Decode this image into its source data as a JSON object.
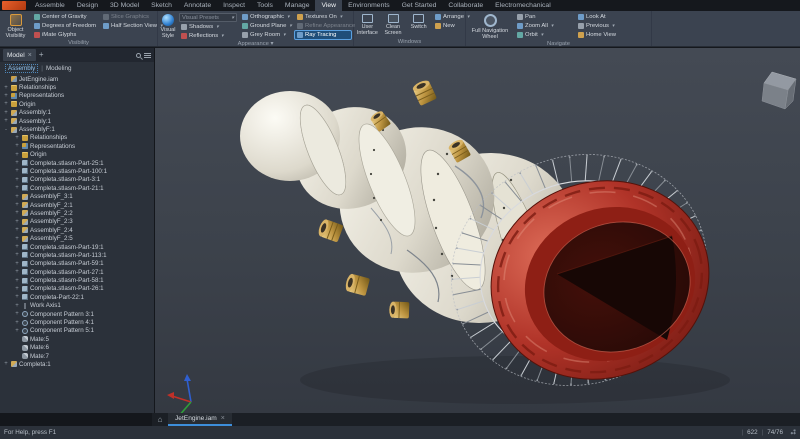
{
  "app": {
    "tabs": [
      {
        "label": "Assemble"
      },
      {
        "label": "Design"
      },
      {
        "label": "3D Model"
      },
      {
        "label": "Sketch"
      },
      {
        "label": "Annotate"
      },
      {
        "label": "Inspect"
      },
      {
        "label": "Tools"
      },
      {
        "label": "Manage"
      },
      {
        "label": "View",
        "cls": "active"
      },
      {
        "label": "Environments"
      },
      {
        "label": "Get Started"
      },
      {
        "label": "Collaborate"
      },
      {
        "label": "Electromechanical"
      }
    ]
  },
  "ribbon": {
    "visibility": {
      "label": "Visibility",
      "big": "Object Visibility",
      "col1": [
        "Center of Gravity",
        "Degrees of Freedom",
        "iMate Glyphs"
      ],
      "col2": [
        "Slice Graphics",
        "Half Section View"
      ]
    },
    "appearance": {
      "label": "Appearance ▾",
      "big": "Visual Style",
      "colA": [
        "Visual Presets",
        "Shadows",
        "Reflections"
      ],
      "colB": [
        "Orthographic",
        "Ground Plane",
        "Grey Room"
      ],
      "colC": [
        "Textures On",
        "Refine Appearance",
        "Ray Tracing"
      ]
    },
    "windows": {
      "label": "Windows",
      "items": [
        "User Interface",
        "Clean Screen",
        "Switch",
        "Arrange",
        "New"
      ]
    },
    "navigate": {
      "label": "Navigate",
      "big": "Full Navigation Wheel",
      "colA": [
        "Pan",
        "Zoom All",
        "Orbit"
      ],
      "colB": [
        "Look At",
        "Previous",
        "Home View"
      ]
    }
  },
  "browser": {
    "panel_tab": "Model",
    "close": "×",
    "add": "+",
    "subtab_assembly": "Assembly",
    "subtab_sep": "|",
    "subtab_modeling": "Modeling",
    "tree": [
      {
        "exp": "",
        "icon": "ti-root",
        "ind": "",
        "label": "JetEngine.iam"
      },
      {
        "exp": "+",
        "icon": "ti-folder",
        "ind": "",
        "label": "Relationships"
      },
      {
        "exp": "+",
        "icon": "ti-rep",
        "ind": "",
        "label": "Representations"
      },
      {
        "exp": "+",
        "icon": "ti-folder",
        "ind": "",
        "label": "Origin"
      },
      {
        "exp": "+",
        "icon": "ti-asm",
        "ind": "",
        "label": "Assembly:1"
      },
      {
        "exp": "+",
        "icon": "ti-asm",
        "ind": "",
        "label": "Assembly:1"
      },
      {
        "exp": "-",
        "icon": "ti-asm",
        "ind": "",
        "label": "AssemblyF:1"
      },
      {
        "exp": "+",
        "icon": "ti-folder",
        "ind": "ind1",
        "label": "Relationships"
      },
      {
        "exp": "+",
        "icon": "ti-rep",
        "ind": "ind1",
        "label": "Representations"
      },
      {
        "exp": "+",
        "icon": "ti-folder",
        "ind": "ind1",
        "label": "Origin"
      },
      {
        "exp": "+",
        "icon": "ti-part",
        "ind": "ind1",
        "label": "Completa.stlasm-Part-25:1"
      },
      {
        "exp": "+",
        "icon": "ti-part",
        "ind": "ind1",
        "label": "Completa.stlasm-Part-100:1"
      },
      {
        "exp": "+",
        "icon": "ti-part",
        "ind": "ind1",
        "label": "Completa.stlasm-Part-3:1"
      },
      {
        "exp": "+",
        "icon": "ti-part",
        "ind": "ind1",
        "label": "Completa.stlasm-Part-21:1"
      },
      {
        "exp": "+",
        "icon": "ti-asm",
        "ind": "ind1",
        "label": "AssemblyF_3:1"
      },
      {
        "exp": "+",
        "icon": "ti-asm",
        "ind": "ind1",
        "label": "AssemblyF_2:1"
      },
      {
        "exp": "+",
        "icon": "ti-asm",
        "ind": "ind1",
        "label": "AssemblyF_2:2"
      },
      {
        "exp": "+",
        "icon": "ti-asm",
        "ind": "ind1",
        "label": "AssemblyF_2:3"
      },
      {
        "exp": "+",
        "icon": "ti-asm",
        "ind": "ind1",
        "label": "AssemblyF_2:4"
      },
      {
        "exp": "+",
        "icon": "ti-asm",
        "ind": "ind1",
        "label": "AssemblyF_2:5"
      },
      {
        "exp": "+",
        "icon": "ti-part",
        "ind": "ind1",
        "label": "Completa.stlasm-Part-19:1"
      },
      {
        "exp": "+",
        "icon": "ti-part",
        "ind": "ind1",
        "label": "Completa.stlasm-Part-113:1"
      },
      {
        "exp": "+",
        "icon": "ti-part",
        "ind": "ind1",
        "label": "Completa.stlasm-Part-59:1"
      },
      {
        "exp": "+",
        "icon": "ti-part",
        "ind": "ind1",
        "label": "Completa.stlasm-Part-27:1"
      },
      {
        "exp": "+",
        "icon": "ti-part",
        "ind": "ind1",
        "label": "Completa.stlasm-Part-58:1"
      },
      {
        "exp": "+",
        "icon": "ti-part",
        "ind": "ind1",
        "label": "Completa.stlasm-Part-26:1"
      },
      {
        "exp": "+",
        "icon": "ti-part",
        "ind": "ind1",
        "label": "Completa-Part-22:1"
      },
      {
        "exp": "+",
        "icon": "ti-axis",
        "ind": "ind1",
        "label": "Work Axis1"
      },
      {
        "exp": "+",
        "icon": "ti-pat",
        "ind": "ind1",
        "label": "Component Pattern 3:1"
      },
      {
        "exp": "+",
        "icon": "ti-pat",
        "ind": "ind1",
        "label": "Component Pattern 4:1"
      },
      {
        "exp": "+",
        "icon": "ti-pat",
        "ind": "ind1",
        "label": "Component Pattern 5:1"
      },
      {
        "exp": "",
        "icon": "ti-mate",
        "ind": "ind1",
        "label": "Mate:5"
      },
      {
        "exp": "",
        "icon": "ti-mate",
        "ind": "ind1",
        "label": "Mate:6"
      },
      {
        "exp": "",
        "icon": "ti-mate",
        "ind": "ind1",
        "label": "Mate:7"
      },
      {
        "exp": "+",
        "icon": "ti-asm",
        "ind": "",
        "label": "Completa:1"
      }
    ]
  },
  "doc_tabs": {
    "home_icon": "⌂",
    "active": "JetEngine.iam",
    "close": "×"
  },
  "status": {
    "help": "For Help, press F1",
    "v1": "622",
    "v2": "74/76"
  },
  "colors": {
    "accent": "#3d8edb",
    "ribbon_bg": "#3b4350",
    "engine_body": "#ece9dd",
    "engine_gold": "#c9a04a",
    "engine_red": "#b03328",
    "highlight_button": "#1f4e79"
  }
}
